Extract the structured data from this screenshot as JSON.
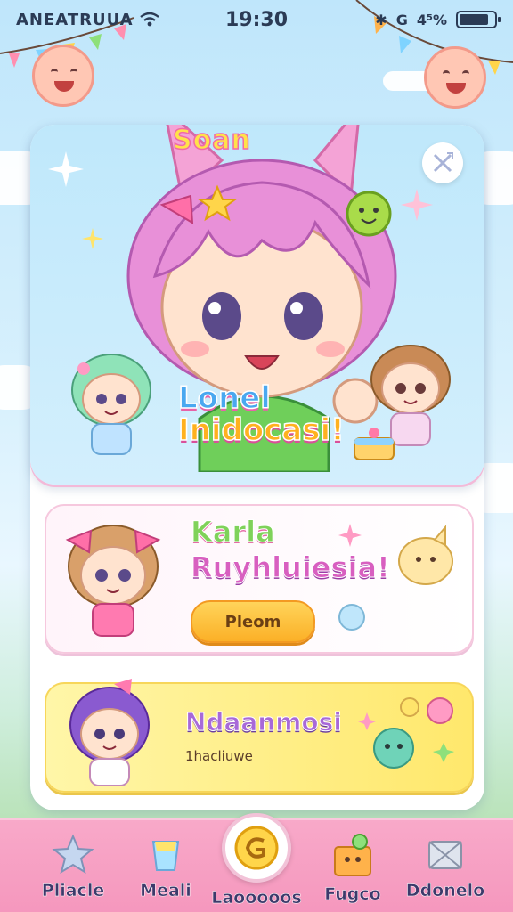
{
  "status_bar": {
    "carrier": "ANEATRUUA",
    "time": "19:30",
    "battery": "4⁵%",
    "battery_level": 0.85
  },
  "hero": {
    "title": "Soan",
    "caption_line1": "Lonel",
    "caption_line2": "Inidocasi!",
    "close_icon": "sparkle-close-icon"
  },
  "card_feature": {
    "title_line1": "Karla",
    "title_line2": "Ruyhluiesia!",
    "button_label": "Pleom"
  },
  "card_secondary": {
    "title": "Ndaanmosi",
    "subtitle": "1hacliuwe"
  },
  "tabs": [
    {
      "label": "Pliacle",
      "icon": "star-icon"
    },
    {
      "label": "Meali",
      "icon": "cup-icon"
    },
    {
      "label": "Laooooos",
      "icon": "coin-icon"
    },
    {
      "label": "Fugco",
      "icon": "gift-box-icon"
    },
    {
      "label": "Ddonelo",
      "icon": "envelope-icon"
    }
  ],
  "colors": {
    "accent_pink": "#f597bd",
    "accent_yellow": "#ffd45a",
    "sky": "#bfe6fb"
  }
}
